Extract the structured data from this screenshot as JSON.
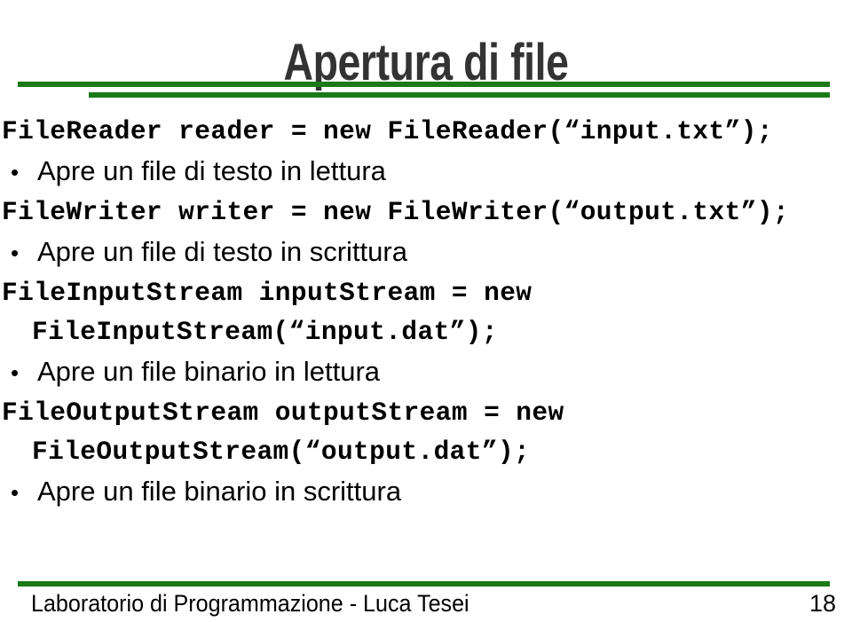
{
  "slide": {
    "title": "Apertura di file",
    "accent_color": "#1a7a17",
    "title_color": "#333333",
    "text_color": "#000000"
  },
  "content": {
    "blocks": [
      {
        "kind": "code",
        "lines": [
          "FileReader reader = new FileReader(“input.txt”);"
        ]
      },
      {
        "kind": "bullet",
        "marker": "•",
        "text": "Apre un file di testo in lettura"
      },
      {
        "kind": "code",
        "lines": [
          "FileWriter writer = new FileWriter(“output.txt”);"
        ]
      },
      {
        "kind": "bullet",
        "marker": "•",
        "text": "Apre un file di testo in scrittura"
      },
      {
        "kind": "code",
        "lines": [
          "FileInputStream inputStream = new",
          "FileInputStream(“input.dat”);"
        ]
      },
      {
        "kind": "bullet",
        "marker": "•",
        "text": "Apre un file binario in lettura"
      },
      {
        "kind": "code",
        "lines": [
          "FileOutputStream outputStream = new",
          "FileOutputStream(“output.dat”);"
        ]
      },
      {
        "kind": "bullet",
        "marker": "•",
        "text": "Apre un file binario in scrittura"
      }
    ]
  },
  "footer": {
    "text": "Laboratorio di Programmazione - Luca Tesei",
    "page_number": "18"
  }
}
